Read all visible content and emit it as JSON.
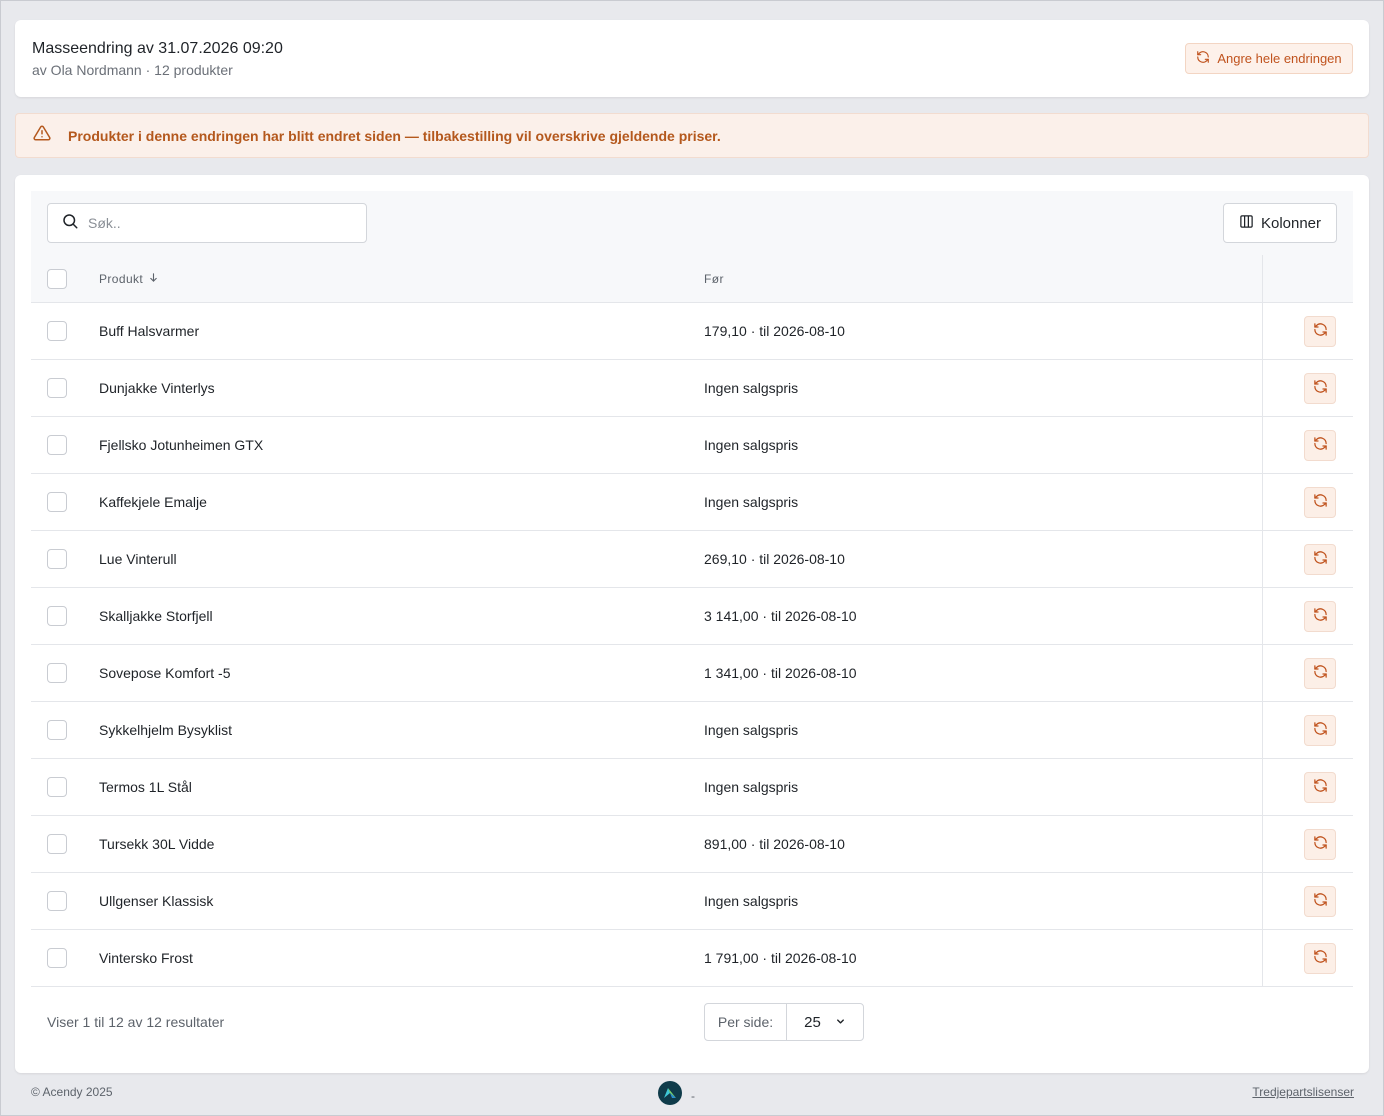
{
  "header": {
    "title": "Masseendring av 31.07.2026 09:20",
    "subtitle": "av Ola Nordmann · 12 produkter",
    "undo_all_label": "Angre hele endringen"
  },
  "alert": {
    "text": "Produkter i denne endringen har blitt endret siden — tilbakestilling vil overskrive gjeldende priser."
  },
  "toolbar": {
    "search_placeholder": "Søk..",
    "columns_label": "Kolonner"
  },
  "table": {
    "headers": {
      "product": "Produkt",
      "before": "Før"
    },
    "rows": [
      {
        "product": "Buff Halsvarmer",
        "before": "179,10 · til 2026-08-10"
      },
      {
        "product": "Dunjakke Vinterlys",
        "before": "Ingen salgspris"
      },
      {
        "product": "Fjellsko Jotunheimen GTX",
        "before": "Ingen salgspris"
      },
      {
        "product": "Kaffekjele Emalje",
        "before": "Ingen salgspris"
      },
      {
        "product": "Lue Vinterull",
        "before": "269,10 · til 2026-08-10"
      },
      {
        "product": "Skalljakke Storfjell",
        "before": "3 141,00 · til 2026-08-10"
      },
      {
        "product": "Sovepose Komfort -5",
        "before": "1 341,00 · til 2026-08-10"
      },
      {
        "product": "Sykkelhjelm Bysyklist",
        "before": "Ingen salgspris"
      },
      {
        "product": "Termos 1L Stål",
        "before": "Ingen salgspris"
      },
      {
        "product": "Tursekk 30L Vidde",
        "before": "891,00 · til 2026-08-10"
      },
      {
        "product": "Ullgenser Klassisk",
        "before": "Ingen salgspris"
      },
      {
        "product": "Vintersko Frost",
        "before": "1 791,00 · til 2026-08-10"
      }
    ]
  },
  "pagination": {
    "results_text": "Viser 1 til 12 av 12 resultater",
    "per_page_label": "Per side:",
    "per_page_value": "25"
  },
  "footer": {
    "copyright": "© Acendy 2025",
    "center_text": "-",
    "licenses_label": "Tredjepartslisenser"
  },
  "colors": {
    "accent": "#c0531e",
    "alert_text": "#b4581d",
    "background": "#e8e9ed"
  }
}
